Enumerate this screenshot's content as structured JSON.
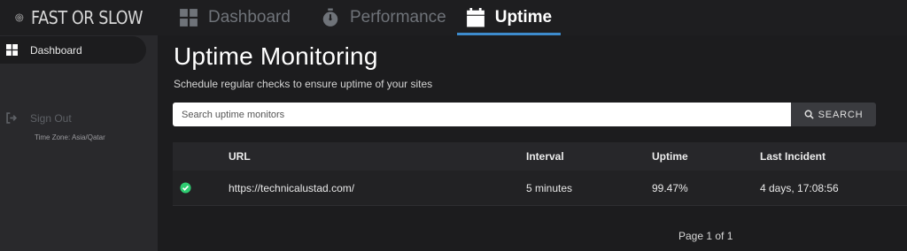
{
  "app": {
    "name": "FAST OR SLOW"
  },
  "nav": {
    "tabs": [
      {
        "label": "Dashboard",
        "icon": "grid-icon",
        "active": false
      },
      {
        "label": "Performance",
        "icon": "stopwatch-icon",
        "active": false
      },
      {
        "label": "Uptime",
        "icon": "calendar-icon",
        "active": true
      }
    ]
  },
  "sidebar": {
    "items": [
      {
        "label": "Dashboard",
        "icon": "grid-icon",
        "active": true
      },
      {
        "label": "Sign Out",
        "icon": "sign-out-icon",
        "active": false
      }
    ],
    "timezone": "Time Zone: Asia/Qatar"
  },
  "main": {
    "title": "Uptime Monitoring",
    "subtitle": "Schedule regular checks to ensure uptime of your sites",
    "search": {
      "placeholder": "Search uptime monitors",
      "button_label": "SEARCH"
    },
    "table": {
      "headers": [
        "URL",
        "Interval",
        "Uptime",
        "Last Incident"
      ],
      "rows": [
        {
          "status": "up",
          "url": "https://technicalustad.com/",
          "interval": "5 minutes",
          "uptime": "99.47%",
          "last_incident": "4 days, 17:08:56"
        }
      ]
    },
    "pagination": "Page 1 of 1"
  },
  "colors": {
    "accent": "#3d8bcd",
    "status_up": "#2ecc71",
    "background": "#1c1c1e",
    "sidebar": "#29292c"
  }
}
